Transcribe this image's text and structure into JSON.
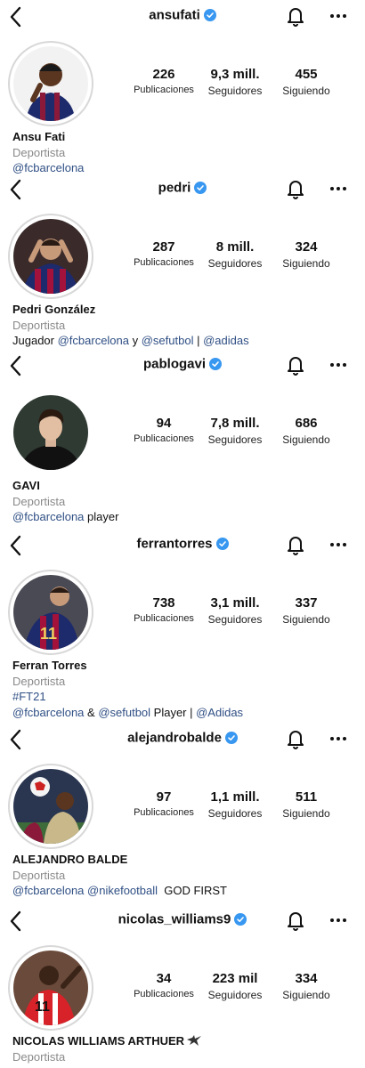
{
  "labels": {
    "posts": "Publicaciones",
    "followers": "Seguidores",
    "following": "Siguiendo"
  },
  "colors": {
    "verified": "#3897f0",
    "link": "#2f4f84",
    "category": "#8a8a8a"
  },
  "profiles": [
    {
      "username": "ansufati",
      "posts": "226",
      "followers": "9,3 mill.",
      "following": "455",
      "full_name": "Ansu Fati",
      "category": "Deportista",
      "bio": {
        "link1": "@fcbarcelona"
      }
    },
    {
      "username": "pedri",
      "posts": "287",
      "followers": "8 mill.",
      "following": "324",
      "full_name": "Pedri González",
      "category": "Deportista",
      "bio": {
        "t1": "Jugador ",
        "link1": "@fcbarcelona",
        "t2": " y ",
        "link2": "@sefutbol",
        "t3": " | ",
        "link3": "@adidas"
      }
    },
    {
      "username": "pablogavi",
      "posts": "94",
      "followers": "7,8 mill.",
      "following": "686",
      "full_name": "GAVI",
      "category": "Deportista",
      "bio": {
        "link1": "@fcbarcelona",
        "t1": " player"
      }
    },
    {
      "username": "ferrantorres",
      "posts": "738",
      "followers": "3,1 mill.",
      "following": "337",
      "full_name": "Ferran Torres",
      "category": "Deportista",
      "bio": {
        "hashtag": "#FT21",
        "link1": "@fcbarcelona",
        "t1": " & ",
        "link2": "@sefutbol",
        "t2": " Player | ",
        "link3": "@Adidas"
      }
    },
    {
      "username": "alejandrobalde",
      "posts": "97",
      "followers": "1,1 mill.",
      "following": "511",
      "full_name": "ALEJANDRO BALDE",
      "category": "Deportista",
      "bio": {
        "link1": "@fcbarcelona",
        "t1": " ",
        "link2": "@nikefootball",
        "t2": "  GOD FIRST"
      }
    },
    {
      "username": "nicolas_williams9",
      "posts": "34",
      "followers": "223 mil",
      "following": "334",
      "full_name": "NICOLAS WILLIAMS ARTHUER",
      "category": "Deportista",
      "bio": {}
    }
  ]
}
